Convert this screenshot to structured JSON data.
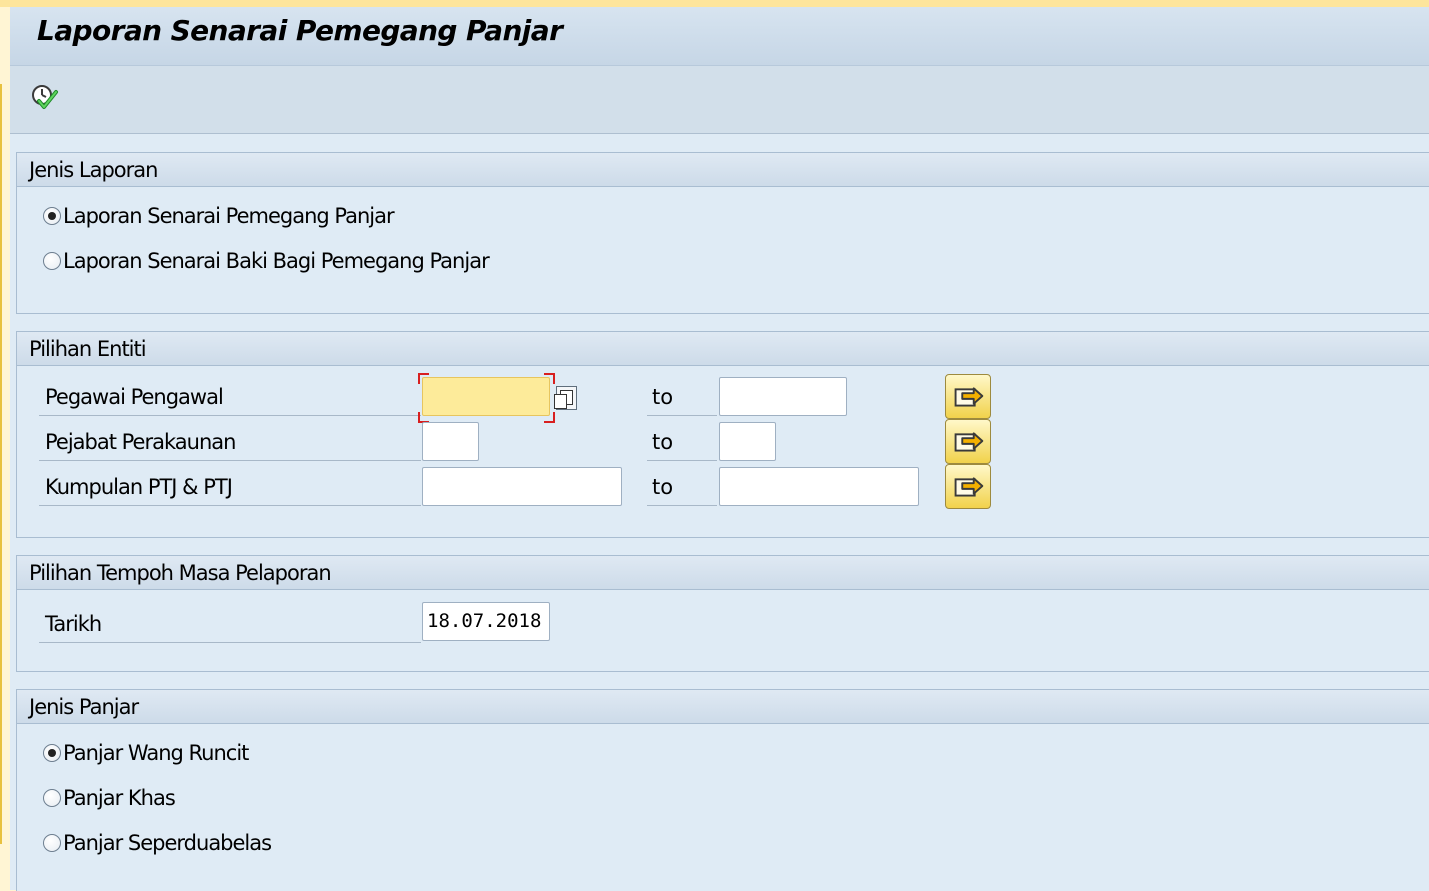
{
  "window": {
    "title": "Laporan Senarai Pemegang Panjar"
  },
  "toolbar": {
    "execute_icon": "execute-icon"
  },
  "report_type": {
    "title": "Jenis Laporan",
    "options": [
      {
        "label": "Laporan Senarai Pemegang Panjar",
        "selected": true
      },
      {
        "label": "Laporan Senarai Baki Bagi Pemegang Panjar",
        "selected": false
      }
    ]
  },
  "entity_selection": {
    "title": "Pilihan Entiti",
    "to_label": "to",
    "rows": [
      {
        "label": "Pegawai Pengawal",
        "from": "",
        "to": ""
      },
      {
        "label": "Pejabat Perakaunan",
        "from": "",
        "to": ""
      },
      {
        "label": "Kumpulan PTJ & PTJ",
        "from": "",
        "to": ""
      }
    ]
  },
  "period_selection": {
    "title": "Pilihan Tempoh Masa Pelaporan",
    "date_label": "Tarikh",
    "date_value": "18.07.2018"
  },
  "advance_type": {
    "title": "Jenis Panjar",
    "options": [
      {
        "label": "Panjar Wang Runcit",
        "selected": true
      },
      {
        "label": "Panjar Khas",
        "selected": false
      },
      {
        "label": "Panjar Seperduabelas",
        "selected": false
      }
    ]
  },
  "colors": {
    "background": "#dfebf5",
    "focus_field": "#fdeb9a",
    "multi_button": "#f1d24b"
  }
}
